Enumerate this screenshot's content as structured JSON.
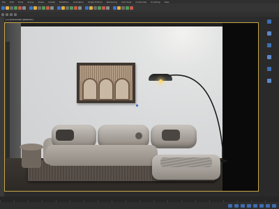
{
  "menubar": {
    "items": [
      "File",
      "Edit",
      "Tools",
      "Group",
      "Views",
      "Create",
      "Modifiers",
      "Animation",
      "Graph Editors",
      "Rendering",
      "Civil View",
      "Customize",
      "Scripting",
      "Help"
    ]
  },
  "viewport": {
    "label": "[+] [Camera01] [Realistic]"
  },
  "colors": {
    "accent": "#3a6fb5",
    "viewport_border": "#c8a84a",
    "wall": "#d8d9da",
    "floor": "#342f2a",
    "sofa": "#b4aea7",
    "lamp_light": "#ffd66b"
  },
  "toolbar": {
    "icons": [
      "undo-icon",
      "redo-icon",
      "link-icon",
      "unlink-icon",
      "bind-icon",
      "select-filter-icon",
      "select-icon",
      "select-by-name-icon",
      "rect-select-icon",
      "window-crossing-icon",
      "move-icon",
      "rotate-icon",
      "scale-icon",
      "reference-coord-icon",
      "pivot-icon",
      "snap-icon",
      "angle-snap-icon",
      "percent-snap-icon",
      "spinner-snap-icon",
      "named-selection-icon",
      "mirror-icon",
      "align-icon",
      "layer-icon",
      "curve-editor-icon",
      "schematic-icon",
      "material-editor-icon",
      "render-setup-icon",
      "render-frame-icon",
      "render-icon"
    ]
  },
  "right_panel": {
    "icons": [
      "create-icon",
      "modify-icon",
      "hierarchy-icon",
      "motion-icon",
      "display-icon",
      "utilities-icon"
    ]
  },
  "statusbar": {
    "icons": [
      "play-icon",
      "stop-icon",
      "key-icon",
      "time-config-icon",
      "zoom-icon",
      "pan-icon",
      "orbit-icon",
      "maximize-icon"
    ]
  }
}
